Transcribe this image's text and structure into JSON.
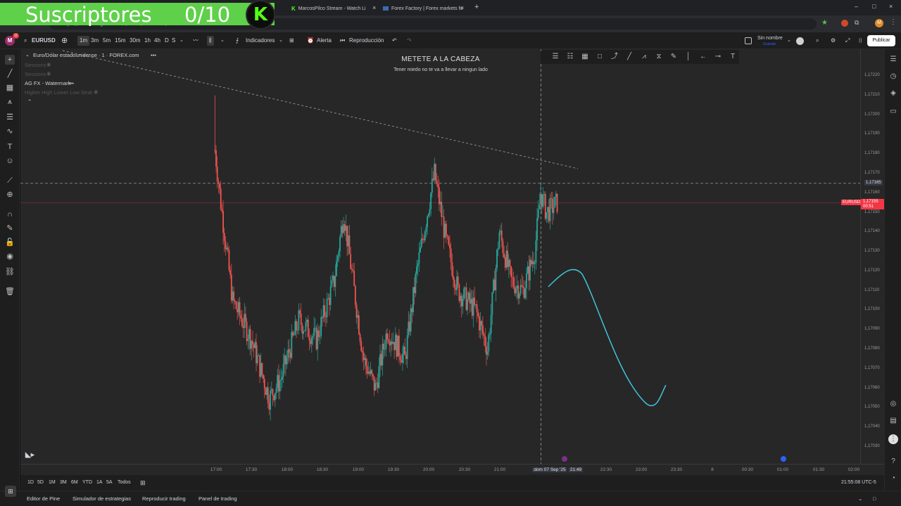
{
  "browser": {
    "tabs": [
      {
        "label": "MarcosPilco Stream - Watch Li",
        "icon": "kick-favicon"
      },
      {
        "label": "Forex Factory | Forex markets fo",
        "icon": "forexfactory-favicon"
      }
    ],
    "url": "https://es.tradingview.com/chart/RlEPc8PC/"
  },
  "overlay": {
    "subscribers_label": "Suscriptores",
    "subscribers_count": "0/10",
    "logo_letter": "K",
    "accent": "#5fd04a",
    "kick_green": "#53fc18"
  },
  "toolbar": {
    "avatar_letter": "M",
    "avatar_badge": "11",
    "symbol": "EURUSD",
    "intervals": [
      "1m",
      "3m",
      "5m",
      "15m",
      "30m",
      "1h",
      "4h",
      "D",
      "S"
    ],
    "active_interval": "1m",
    "indicators_label": "Indicadores",
    "alert_label": "Alerta",
    "replay_label": "Reproducción",
    "layout_name": "Sin nombre",
    "layout_status": "Guardar",
    "publish_label": "Publicar"
  },
  "legend": {
    "symbol_line": "Euro/Dólar estadounidense · 1 · FOREX.com",
    "indicators": [
      {
        "label": "Sessions",
        "dim": true
      },
      {
        "label": "Sessions",
        "dim": true
      },
      {
        "label": "AG FX - Watermark",
        "dim": false
      },
      {
        "label": "Higher High Lower Low Strat",
        "dim": true
      }
    ]
  },
  "annotations": {
    "title": "METETE A LA CABEZA",
    "subtitle": "Tener miedo no te va a llevar a ningun lado",
    "curve_color": "#3ec6d9"
  },
  "chart_data": {
    "type": "candlestick",
    "symbol": "EURUSD",
    "interval": "1m",
    "ylim": [
      1.1703,
      1.1722
    ],
    "y_ticks": [
      "1,17220",
      "1,17210",
      "1,17200",
      "1,17190",
      "1,17180",
      "1,17170",
      "1,17160",
      "1,17150",
      "1,17140",
      "1,17130",
      "1,17120",
      "1,17110",
      "1,17100",
      "1,17090",
      "1,17080",
      "1,17070",
      "1,17060",
      "1,17050",
      "1,17040",
      "1,17030"
    ],
    "x_ticks": [
      "17:00",
      "17:30",
      "18:00",
      "18:30",
      "19:00",
      "19:30",
      "20:00",
      "20:30",
      "21:00",
      "dom 07 Sep '25",
      "21:49",
      "22:30",
      "23:00",
      "23:30",
      "8",
      "00:30",
      "01:00",
      "01:30",
      "02:00"
    ],
    "close_path": [
      {
        "t": "16:59",
        "v": 1.17182
      },
      {
        "t": "17:04",
        "v": 1.17155
      },
      {
        "t": "17:14",
        "v": 1.17105
      },
      {
        "t": "17:30",
        "v": 1.17085
      },
      {
        "t": "17:45",
        "v": 1.17055
      },
      {
        "t": "17:55",
        "v": 1.17065
      },
      {
        "t": "18:10",
        "v": 1.17095
      },
      {
        "t": "18:25",
        "v": 1.17085
      },
      {
        "t": "18:40",
        "v": 1.17115
      },
      {
        "t": "18:48",
        "v": 1.1715
      },
      {
        "t": "19:05",
        "v": 1.17075
      },
      {
        "t": "19:15",
        "v": 1.1706
      },
      {
        "t": "19:25",
        "v": 1.1709
      },
      {
        "t": "19:40",
        "v": 1.17075
      },
      {
        "t": "19:50",
        "v": 1.1712
      },
      {
        "t": "20:05",
        "v": 1.1717
      },
      {
        "t": "20:15",
        "v": 1.17135
      },
      {
        "t": "20:25",
        "v": 1.1711
      },
      {
        "t": "20:40",
        "v": 1.171
      },
      {
        "t": "20:50",
        "v": 1.1708
      },
      {
        "t": "21:00",
        "v": 1.1714
      },
      {
        "t": "21:10",
        "v": 1.17115
      },
      {
        "t": "21:20",
        "v": 1.1711
      },
      {
        "t": "21:30",
        "v": 1.1713
      },
      {
        "t": "21:35",
        "v": 1.1716
      },
      {
        "t": "21:40",
        "v": 1.1715
      },
      {
        "t": "21:49",
        "v": 1.17155
      }
    ],
    "current_price": {
      "symbol": "EURUSD",
      "value": "1,17155",
      "countdown": "00:51",
      "color": "#f23645"
    },
    "crosshair_price": "1,17165",
    "trendline": "descending dashed line from 16:30 to 22:00",
    "grid": false
  },
  "range_bar": {
    "ranges": [
      "1D",
      "5D",
      "1M",
      "3M",
      "6M",
      "YTD",
      "1A",
      "5A",
      "Todos"
    ],
    "clock": "21:55:08 UTC-5"
  },
  "bottom": {
    "tabs": [
      "Editor de Pine",
      "Simulador de estrategias",
      "Reproducir trading",
      "Panel de trading"
    ]
  }
}
